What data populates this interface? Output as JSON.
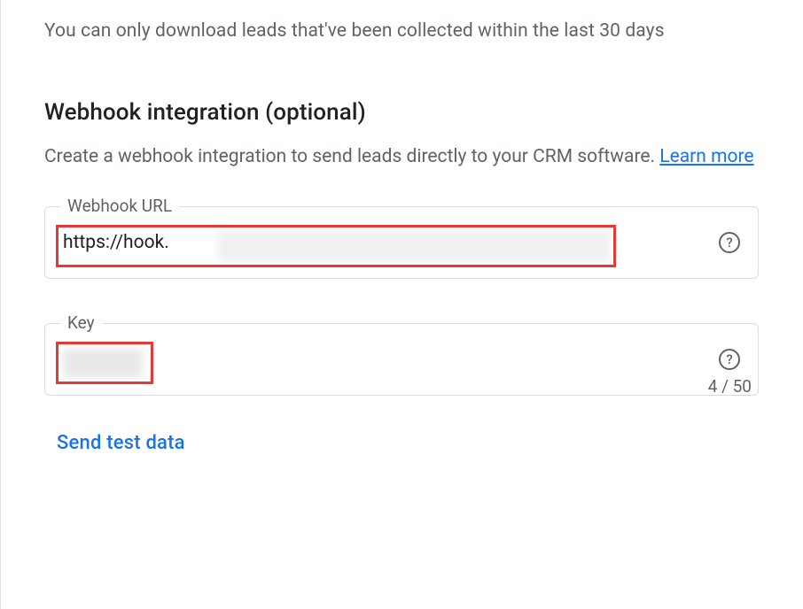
{
  "info": {
    "download_note": "You can only download leads that've been collected within the last 30 days"
  },
  "webhook": {
    "heading": "Webhook integration (optional)",
    "description_prefix": "Create a webhook integration to send leads directly to your CRM software. ",
    "learn_more": "Learn more",
    "url_field": {
      "label": "Webhook URL",
      "value": "https://hook."
    },
    "key_field": {
      "label": "Key",
      "value": "",
      "counter": "4 / 50"
    },
    "send_test": "Send test data"
  }
}
